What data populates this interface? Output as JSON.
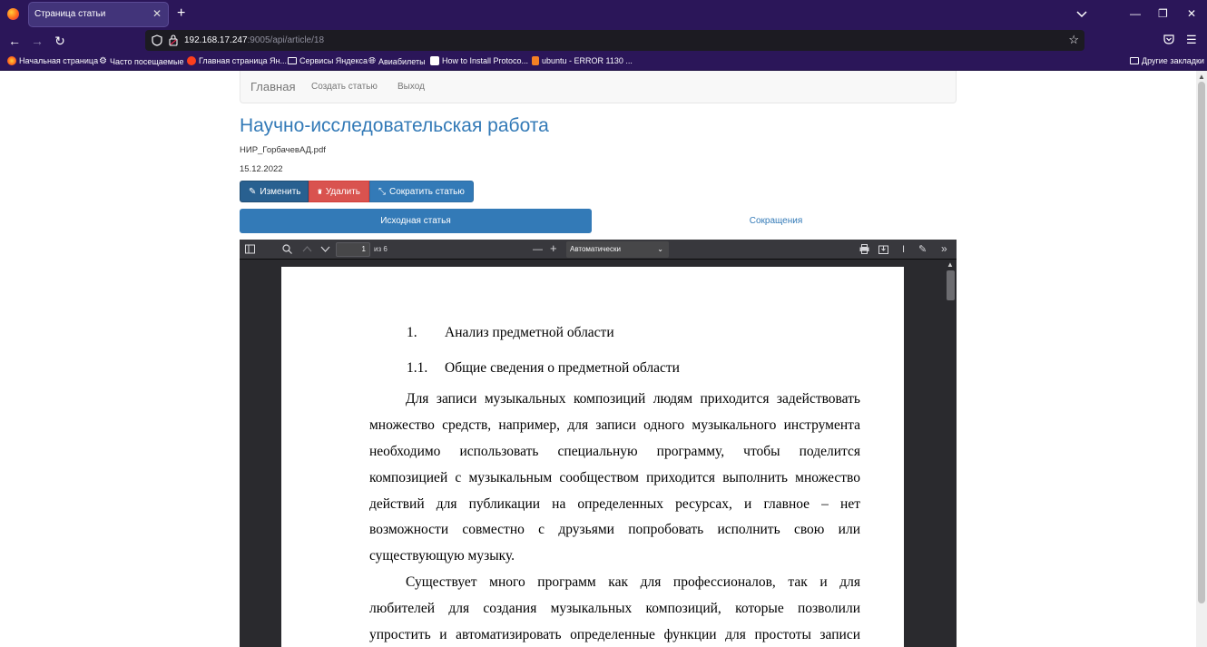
{
  "browser": {
    "tab_title": "Страница статьи",
    "url_host": "192.168.17.247",
    "url_path": ":9005/api/article/18",
    "bookmarks": [
      "Начальная страница",
      "Часто посещаемые",
      "Главная страница Ян...",
      "Сервисы Яндекса",
      "Авиабилеты",
      "How to Install Protoco...",
      "ubuntu - ERROR 1130 ..."
    ],
    "other_bookmarks": "Другие закладки"
  },
  "site": {
    "brand": "Главная",
    "nav": [
      "Создать статью",
      "Выход"
    ]
  },
  "article": {
    "title": "Научно-исследовательская работа",
    "filename": "НИР_ГорбачевАД.pdf",
    "date": "15.12.2022",
    "buttons": {
      "edit": "Изменить",
      "delete": "Удалить",
      "shorten": "Сократить статью"
    },
    "tabs": {
      "original": "Исходная статья",
      "abbrev": "Сокращения"
    }
  },
  "pdf": {
    "page_number": "1",
    "page_of": "из 6",
    "zoom": "Автоматически",
    "heading1_num": "1.",
    "heading1": "Анализ предметной области",
    "heading2_num": "1.1.",
    "heading2": "Общие сведения о предметной области",
    "para1_lines": [
      "Для записи музыкальных композиций людям приходится задействовать",
      "множество средств, например, для записи одного музыкального инструмента",
      "необходимо использовать специальную программу, чтобы поделится",
      "композицией с музыкальным сообществом приходится выполнить множество",
      "действий для публикации на определенных ресурсах, и главное – нет",
      "возможности совместно с друзьями попробовать исполнить свою или",
      "существующую музыку."
    ],
    "para2_lines": [
      "Существует много программ как для профессионалов, так и для",
      "любителей для создания музыкальных композиций, которые позволили",
      "упростить и автоматизировать определенные функции для простоты записи"
    ]
  }
}
